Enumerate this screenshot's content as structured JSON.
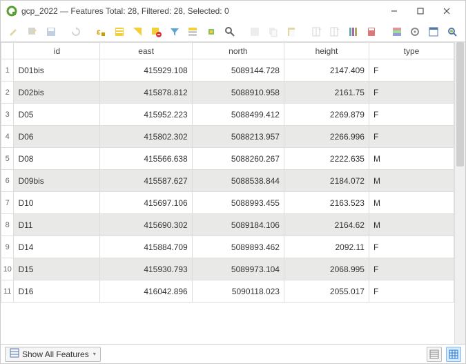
{
  "window": {
    "title": "gcp_2022 — Features Total: 28, Filtered: 28, Selected: 0"
  },
  "statusbar": {
    "show_all": "Show All Features"
  },
  "table": {
    "columns": [
      "id",
      "east",
      "north",
      "height",
      "type"
    ],
    "rows": [
      {
        "n": "1",
        "id": "D01bis",
        "east": "415929.108",
        "north": "5089144.728",
        "height": "2147.409",
        "type": "F"
      },
      {
        "n": "2",
        "id": "D02bis",
        "east": "415878.812",
        "north": "5088910.958",
        "height": "2161.75",
        "type": "F"
      },
      {
        "n": "3",
        "id": "D05",
        "east": "415952.223",
        "north": "5088499.412",
        "height": "2269.879",
        "type": "F"
      },
      {
        "n": "4",
        "id": "D06",
        "east": "415802.302",
        "north": "5088213.957",
        "height": "2266.996",
        "type": "F"
      },
      {
        "n": "5",
        "id": "D08",
        "east": "415566.638",
        "north": "5088260.267",
        "height": "2222.635",
        "type": "M"
      },
      {
        "n": "6",
        "id": "D09bis",
        "east": "415587.627",
        "north": "5088538.844",
        "height": "2184.072",
        "type": "M"
      },
      {
        "n": "7",
        "id": "D10",
        "east": "415697.106",
        "north": "5088993.455",
        "height": "2163.523",
        "type": "M"
      },
      {
        "n": "8",
        "id": "D11",
        "east": "415690.302",
        "north": "5089184.106",
        "height": "2164.62",
        "type": "M"
      },
      {
        "n": "9",
        "id": "D14",
        "east": "415884.709",
        "north": "5089893.462",
        "height": "2092.11",
        "type": "F"
      },
      {
        "n": "10",
        "id": "D15",
        "east": "415930.793",
        "north": "5089973.104",
        "height": "2068.995",
        "type": "F"
      },
      {
        "n": "11",
        "id": "D16",
        "east": "416042.896",
        "north": "5090118.023",
        "height": "2055.017",
        "type": "F"
      }
    ]
  }
}
